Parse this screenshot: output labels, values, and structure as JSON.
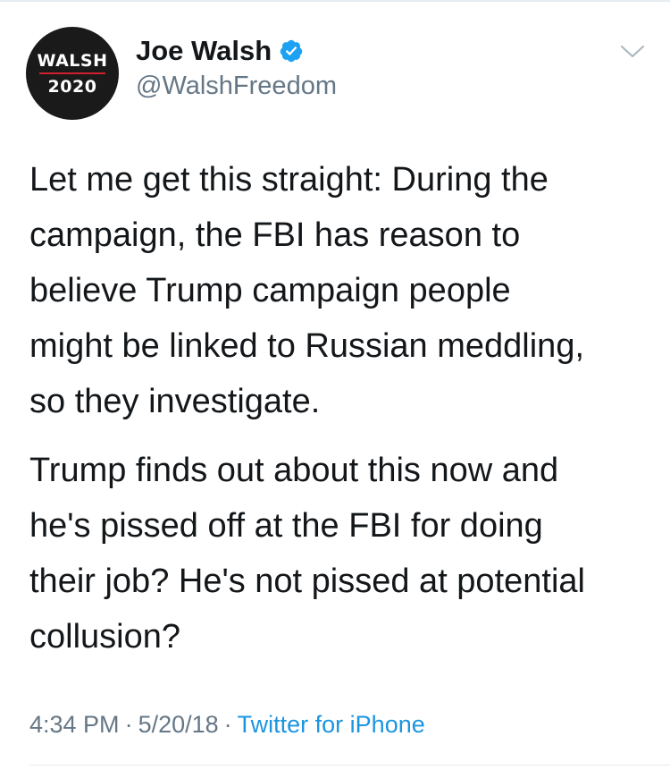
{
  "author": {
    "avatar_text_line1": "WALSH",
    "avatar_text_line2": "2020",
    "display_name": "Joe Walsh",
    "handle": "@WalshFreedom",
    "verified": true,
    "verified_color": "#1da1f2"
  },
  "tweet": {
    "paragraphs": [
      "Let me get this straight: During the\ncampaign, the FBI has reason to\nbelieve Trump campaign people\nmight be linked to Russian meddling,\nso they investigate.",
      "Trump finds out about this now and\nhe's pissed off at the FBI for doing\ntheir job? He's not pissed at potential\ncollusion?"
    ],
    "time": "4:34 PM",
    "separator": "·",
    "date": "5/20/18",
    "source": "Twitter for iPhone"
  },
  "icons": {
    "verified": "verified-badge-icon",
    "menu": "chevron-down-icon"
  },
  "colors": {
    "text": "#14171a",
    "secondary": "#657786",
    "link": "#1b95e0",
    "avatar_bg": "#1a1a1a",
    "avatar_rule": "#d0202b"
  }
}
